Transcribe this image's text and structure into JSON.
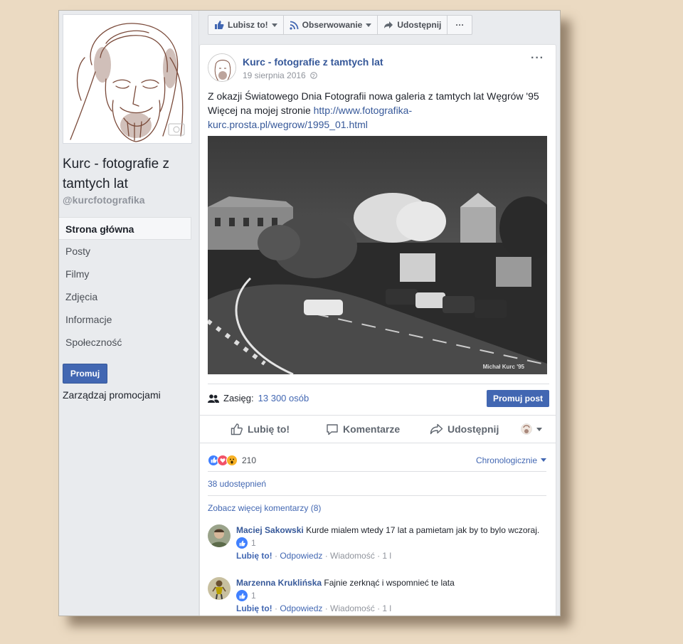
{
  "page": {
    "name": "Kurc - fotografie z tamtych lat",
    "handle": "@kurcfotografika"
  },
  "nav": [
    {
      "label": "Strona główna",
      "active": true
    },
    {
      "label": "Posty"
    },
    {
      "label": "Filmy"
    },
    {
      "label": "Zdjęcia"
    },
    {
      "label": "Informacje"
    },
    {
      "label": "Społeczność"
    }
  ],
  "left": {
    "promote_label": "Promuj",
    "manage_promos_label": "Zarządzaj promocjami"
  },
  "action_bar": {
    "like_label": "Lubisz to!",
    "follow_label": "Obserwowanie",
    "share_label": "Udostępnij",
    "more_label": "···"
  },
  "post": {
    "author": "Kurc - fotografie z tamtych lat",
    "date": "19 sierpnia 2016",
    "menu_label": "···",
    "text_line1": "Z okazji Światowego Dnia Fotografii nowa galeria z tamtych lat Węgrów '95",
    "text_line2_prefix": "Więcej na mojej stronie ",
    "link": "http://www.fotografika-kurc.prosta.pl/wegrow/1995_01.html",
    "image_signature": "Michał Kurc '95",
    "reach_label": "Zasięg:",
    "reach_value": "13 300 osób",
    "promote_post_label": "Promuj post",
    "actions": {
      "like": "Lubię to!",
      "comment": "Komentarze",
      "share": "Udostępnij"
    },
    "reaction_count": "210",
    "sort_label": "Chronologicznie",
    "shares_label": "38 udostępnień",
    "more_comments_label": "Zobacz więcej komentarzy (8)"
  },
  "comments": [
    {
      "author": "Maciej Sakowski",
      "text": "Kurde mialem wtedy 17 lat a pamietam jak by to bylo wczoraj.",
      "likes": "1",
      "like_label": "Lubię to!",
      "reply_label": "Odpowiedz",
      "message_label": "Wiadomość",
      "age": "1 l"
    },
    {
      "author": "Marzenna Kruklińska",
      "text": "Fajnie zerknąć i wspomnieć te lata",
      "likes": "1",
      "like_label": "Lubię to!",
      "reply_label": "Odpowiedz",
      "message_label": "Wiadomość",
      "age": "1 l"
    }
  ],
  "colors": {
    "background": "#ebdac2",
    "brand_blue": "#4267b2",
    "link_blue": "#365899"
  }
}
